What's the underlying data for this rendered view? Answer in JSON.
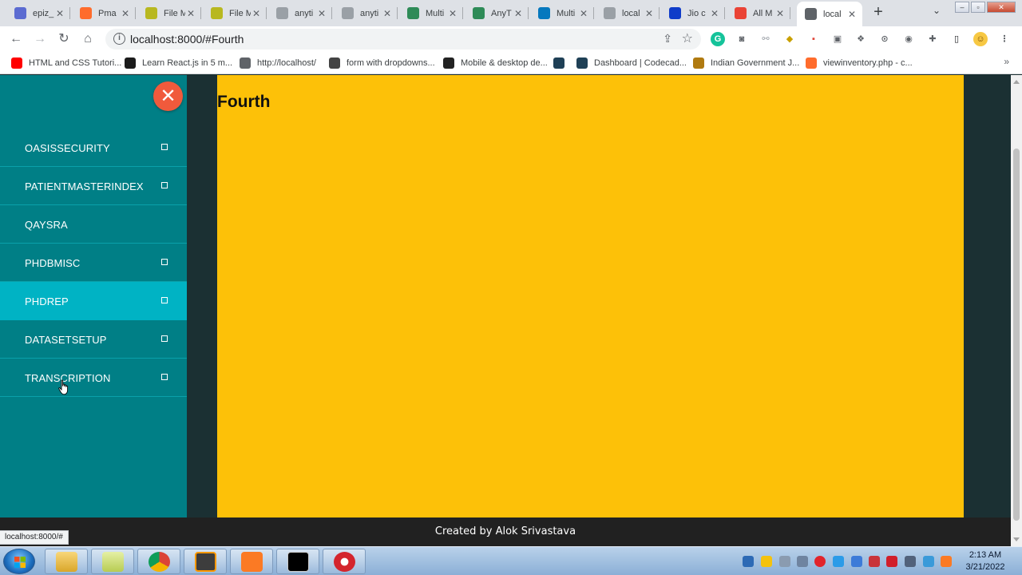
{
  "browser": {
    "tabs": [
      {
        "label": "epiz_",
        "icon": "infinity-icon",
        "color": "#5b6bd1"
      },
      {
        "label": "Pma",
        "icon": "cpanel-icon",
        "color": "#ff6c2c"
      },
      {
        "label": "File M",
        "icon": "file-manager-icon",
        "color": "#b8b820"
      },
      {
        "label": "File M",
        "icon": "file-manager-icon",
        "color": "#b8b820"
      },
      {
        "label": "anyti",
        "icon": "document-icon",
        "color": "#9aa0a6"
      },
      {
        "label": "anyti",
        "icon": "document-icon",
        "color": "#9aa0a6"
      },
      {
        "label": "Multi",
        "icon": "page-icon",
        "color": "#2e8b57"
      },
      {
        "label": "AnyT",
        "icon": "page-icon",
        "color": "#2e8b57"
      },
      {
        "label": "Multi",
        "icon": "drupal-icon",
        "color": "#0678be"
      },
      {
        "label": "local",
        "icon": "localhost-icon",
        "color": "#9aa0a6"
      },
      {
        "label": "Jio c",
        "icon": "jio-icon",
        "color": "#0f3cc9"
      },
      {
        "label": "All M",
        "icon": "gmail-icon",
        "color": "#ea4335"
      },
      {
        "label": "local",
        "icon": "globe-icon",
        "color": "#5f6368",
        "active": true
      }
    ],
    "url": "localhost:8000/#Fourth",
    "bookmarks": [
      {
        "label": "HTML and CSS Tutori...",
        "icon": "youtube-icon",
        "color": "#ff0000"
      },
      {
        "label": "Learn React.js in 5 m...",
        "icon": "scrimba-icon",
        "color": "#1b1b1b"
      },
      {
        "label": "http://localhost/",
        "icon": "globe-icon",
        "color": "#5f6368"
      },
      {
        "label": "form with dropdowns...",
        "icon": "codepen-icon",
        "color": "#444444"
      },
      {
        "label": "Mobile & desktop de...",
        "icon": "figma-icon",
        "color": "#222222"
      },
      {
        "label": "",
        "icon": "codecademy-icon",
        "color": "#1f4056"
      },
      {
        "label": "Dashboard | Codecad...",
        "icon": "codecademy-icon",
        "color": "#1f4056"
      },
      {
        "label": "Indian Government J...",
        "icon": "gov-icon",
        "color": "#b07a10"
      },
      {
        "label": "viewinventory.php - c...",
        "icon": "cpanel-icon",
        "color": "#ff6c2c"
      }
    ],
    "status_url": "localhost:8000/#"
  },
  "sidebar": {
    "close_symbol": "✕",
    "items": [
      {
        "label": "OASISSECURITY",
        "has_submenu": true
      },
      {
        "label": "PATIENTMASTERINDEX",
        "has_submenu": true
      },
      {
        "label": "QAYSRA",
        "has_submenu": false
      },
      {
        "label": "PHDBMISC",
        "has_submenu": true
      },
      {
        "label": "PHDREP",
        "has_submenu": true,
        "active": true
      },
      {
        "label": "DATASETSETUP",
        "has_submenu": true
      },
      {
        "label": "TRANSCRIPTION",
        "has_submenu": true
      }
    ]
  },
  "content": {
    "heading": "Fourth"
  },
  "footer": {
    "text": "Created by Alok Srivastava"
  },
  "taskbar": {
    "clock_time": "2:13 AM",
    "clock_date": "3/21/2022"
  },
  "colors": {
    "sidebar_bg": "#007f86",
    "sidebar_active": "#00b3c4",
    "content_bg": "#fdc108",
    "close_button": "#f05a3c",
    "footer_bg": "#212121",
    "page_bg": "#1b3033"
  }
}
